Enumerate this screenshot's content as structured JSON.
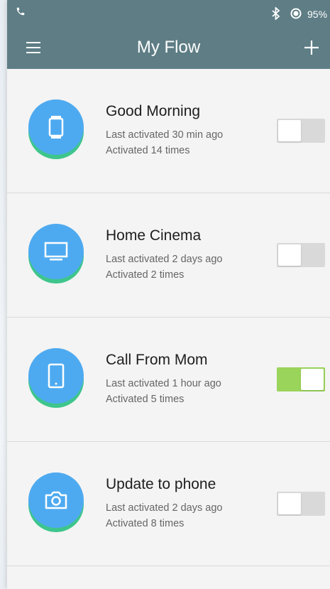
{
  "status_bar": {
    "battery_text": "95%",
    "icons": [
      "phone-icon",
      "bluetooth-icon",
      "location-icon"
    ]
  },
  "app_bar": {
    "title": "My Flow",
    "menu_icon": "hamburger-menu-icon",
    "add_icon": "plus-icon"
  },
  "colors": {
    "header": "#5e7d85",
    "icon_blue": "#4eaaf0",
    "icon_green": "#3ec58c",
    "toggle_on": "#9ad45a",
    "toggle_off": "#d9d9d9"
  },
  "flows": [
    {
      "name": "Good Morning",
      "last_activated": "Last activated 30 min ago",
      "activated_count": "Activated 14 times",
      "icon": "watch-icon",
      "enabled": false
    },
    {
      "name": "Home Cinema",
      "last_activated": "Last activated 2 days ago",
      "activated_count": "Activated 2 times",
      "icon": "monitor-icon",
      "enabled": false
    },
    {
      "name": "Call From Mom",
      "last_activated": "Last activated 1 hour ago",
      "activated_count": "Activated 5 times",
      "icon": "tablet-icon",
      "enabled": true
    },
    {
      "name": "Update to phone",
      "last_activated": "Last activated 2 days ago",
      "activated_count": "Activated 8 times",
      "icon": "camera-icon",
      "enabled": false
    }
  ]
}
